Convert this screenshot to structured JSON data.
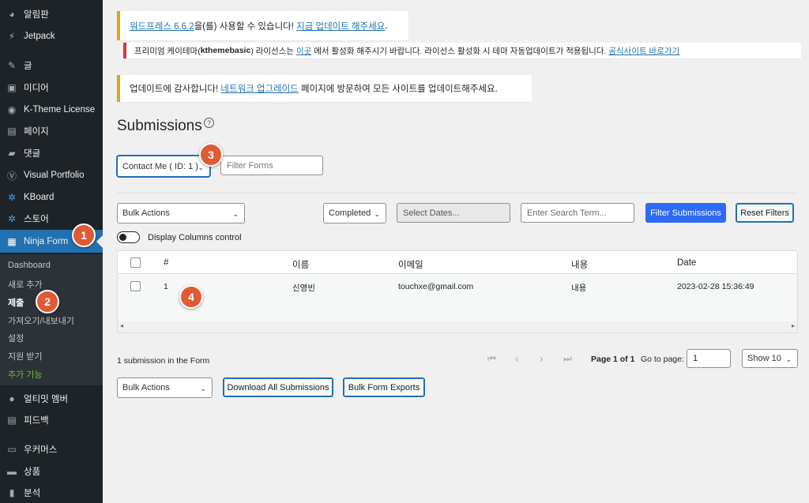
{
  "sidebar": {
    "items": [
      {
        "label": "알림판",
        "icon": "dashboard-icon"
      },
      {
        "label": "Jetpack",
        "icon": "jetpack-icon"
      },
      {
        "label": "글",
        "icon": "pin-icon"
      },
      {
        "label": "미디어",
        "icon": "media-icon"
      },
      {
        "label": "K-Theme License",
        "icon": "license-icon"
      },
      {
        "label": "페이지",
        "icon": "page-icon"
      },
      {
        "label": "댓글",
        "icon": "comment-icon"
      },
      {
        "label": "Visual Portfolio",
        "icon": "portfolio-icon"
      },
      {
        "label": "KBoard",
        "icon": "kboard-icon"
      },
      {
        "label": "스토어",
        "icon": "store-icon"
      },
      {
        "label": "Ninja Form",
        "icon": "form-icon"
      }
    ],
    "submenu": [
      "Dashboard",
      "새로 추가",
      "제출",
      "가져오기/내보내기",
      "설정",
      "지원 받기",
      "추가 기능"
    ],
    "bottom_items": [
      {
        "label": "얼티밋 멤버",
        "icon": "member-icon"
      },
      {
        "label": "피드백",
        "icon": "feedback-icon"
      },
      {
        "label": "우커머스",
        "icon": "woo-icon"
      },
      {
        "label": "상품",
        "icon": "product-icon"
      },
      {
        "label": "분석",
        "icon": "analytics-icon"
      }
    ]
  },
  "notices": {
    "update_link": "워드프레스 6.6.2",
    "update_text": "을(를) 사용할 수 있습니다!",
    "update_now": "지금 업데이트 해주세요",
    "update_end": ".",
    "license_pre": "프리미엄 케이테마(",
    "license_name": "kthemebasic",
    "license_mid": ") 라이선스는",
    "license_here": "이곳",
    "license_post": "에서 활성화 해주시기 바랍니다. 라이선스 활성화 시 테마 자동업데이트가 적용됩니다.",
    "license_site": "공식사이트 바로가기",
    "network_pre": "업데이트에 감사합니다!",
    "network_link": "네트워크 업그레이드",
    "network_post": "페이지에 방문하여 모든 사이트를 업데이트해주세요."
  },
  "page": {
    "title": "Submissions",
    "help": "?"
  },
  "form_select": {
    "value": "Contact Me ( ID: 1 )",
    "filter_placeholder": "Filter Forms"
  },
  "filters": {
    "bulk_actions": "Bulk Actions",
    "status": "Completed",
    "dates_placeholder": "Select Dates...",
    "search_placeholder": "Enter Search Term...",
    "filter_button": "Filter Submissions",
    "reset_button": "Reset Filters",
    "columns_toggle": "Display Columns control"
  },
  "table": {
    "headers": [
      "#",
      "이름",
      "이메일",
      "내용",
      "Date"
    ],
    "rows": [
      {
        "id": "1",
        "name": "신영빈",
        "email": "touchxe@gmail.com",
        "content": "내용",
        "date": "2023-02-28 15:36:49"
      }
    ]
  },
  "footer": {
    "count": "1 submission in the Form",
    "page_info": "Page 1 of 1",
    "go_to": "Go to page:",
    "page_value": "1",
    "show": "Show 10",
    "bulk_actions": "Bulk Actions",
    "download_all": "Download All Submissions",
    "bulk_export": "Bulk Form Exports"
  },
  "badges": [
    "1",
    "2",
    "3",
    "4"
  ],
  "colors": {
    "accent": "#2271b1",
    "primary_button": "#2e6af5",
    "badge": "#e05a33",
    "sidebar": "#1d2327"
  }
}
